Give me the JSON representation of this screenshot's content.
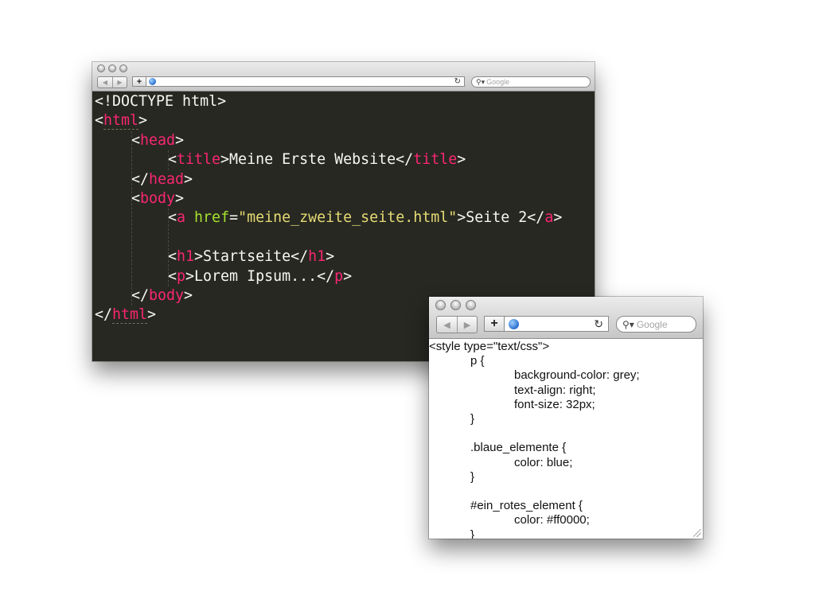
{
  "back_window": {
    "search_placeholder": "Google",
    "code_lines": [
      {
        "indent": 0,
        "tokens": [
          {
            "t": "text",
            "v": "<!DOCTYPE html>"
          }
        ]
      },
      {
        "indent": 0,
        "tokens": [
          {
            "t": "text",
            "v": "<"
          },
          {
            "t": "tagul",
            "v": "html"
          },
          {
            "t": "text",
            "v": ">"
          }
        ]
      },
      {
        "indent": 1,
        "tokens": [
          {
            "t": "text",
            "v": "<"
          },
          {
            "t": "tag",
            "v": "head"
          },
          {
            "t": "text",
            "v": ">"
          }
        ]
      },
      {
        "indent": 2,
        "tokens": [
          {
            "t": "text",
            "v": "<"
          },
          {
            "t": "tag",
            "v": "title"
          },
          {
            "t": "text",
            "v": ">Meine Erste Website</"
          },
          {
            "t": "tag",
            "v": "title"
          },
          {
            "t": "text",
            "v": ">"
          }
        ]
      },
      {
        "indent": 1,
        "tokens": [
          {
            "t": "text",
            "v": "</"
          },
          {
            "t": "tag",
            "v": "head"
          },
          {
            "t": "text",
            "v": ">"
          }
        ]
      },
      {
        "indent": 1,
        "tokens": [
          {
            "t": "text",
            "v": "<"
          },
          {
            "t": "tag",
            "v": "body"
          },
          {
            "t": "text",
            "v": ">"
          }
        ]
      },
      {
        "indent": 2,
        "tokens": [
          {
            "t": "text",
            "v": "<"
          },
          {
            "t": "tag",
            "v": "a"
          },
          {
            "t": "text",
            "v": " "
          },
          {
            "t": "attr",
            "v": "href"
          },
          {
            "t": "text",
            "v": "="
          },
          {
            "t": "str",
            "v": "\"meine_zweite_seite.html\""
          },
          {
            "t": "text",
            "v": ">Seite 2</"
          },
          {
            "t": "tag",
            "v": "a"
          },
          {
            "t": "text",
            "v": ">"
          }
        ]
      },
      {
        "indent": 0,
        "tokens": []
      },
      {
        "indent": 2,
        "tokens": [
          {
            "t": "text",
            "v": "<"
          },
          {
            "t": "tag",
            "v": "h1"
          },
          {
            "t": "text",
            "v": ">Startseite</"
          },
          {
            "t": "tag",
            "v": "h1"
          },
          {
            "t": "text",
            "v": ">"
          }
        ]
      },
      {
        "indent": 2,
        "tokens": [
          {
            "t": "text",
            "v": "<"
          },
          {
            "t": "tag",
            "v": "p"
          },
          {
            "t": "text",
            "v": ">Lorem Ipsum...</"
          },
          {
            "t": "tag",
            "v": "p"
          },
          {
            "t": "text",
            "v": ">"
          }
        ]
      },
      {
        "indent": 1,
        "tokens": [
          {
            "t": "text",
            "v": "</"
          },
          {
            "t": "tag",
            "v": "body"
          },
          {
            "t": "text",
            "v": ">"
          }
        ]
      },
      {
        "indent": 0,
        "tokens": [
          {
            "t": "text",
            "v": "</"
          },
          {
            "t": "tagul",
            "v": "html"
          },
          {
            "t": "text",
            "v": ">"
          }
        ]
      }
    ]
  },
  "front_window": {
    "search_placeholder": "Google",
    "code_lines": [
      {
        "indent": 0,
        "text": "<style type=\"text/css\">"
      },
      {
        "indent": 1,
        "text": "p {"
      },
      {
        "indent": 2,
        "text": "background-color: grey;"
      },
      {
        "indent": 2,
        "text": "text-align: right;"
      },
      {
        "indent": 2,
        "text": "font-size: 32px;"
      },
      {
        "indent": 1,
        "text": "}"
      },
      {
        "indent": 0,
        "text": ""
      },
      {
        "indent": 1,
        "text": ".blaue_elemente {"
      },
      {
        "indent": 2,
        "text": "color: blue;"
      },
      {
        "indent": 1,
        "text": "}"
      },
      {
        "indent": 0,
        "text": ""
      },
      {
        "indent": 1,
        "text": "#ein_rotes_element {"
      },
      {
        "indent": 2,
        "text": "color: #ff0000;"
      },
      {
        "indent": 1,
        "text": "}"
      }
    ]
  }
}
